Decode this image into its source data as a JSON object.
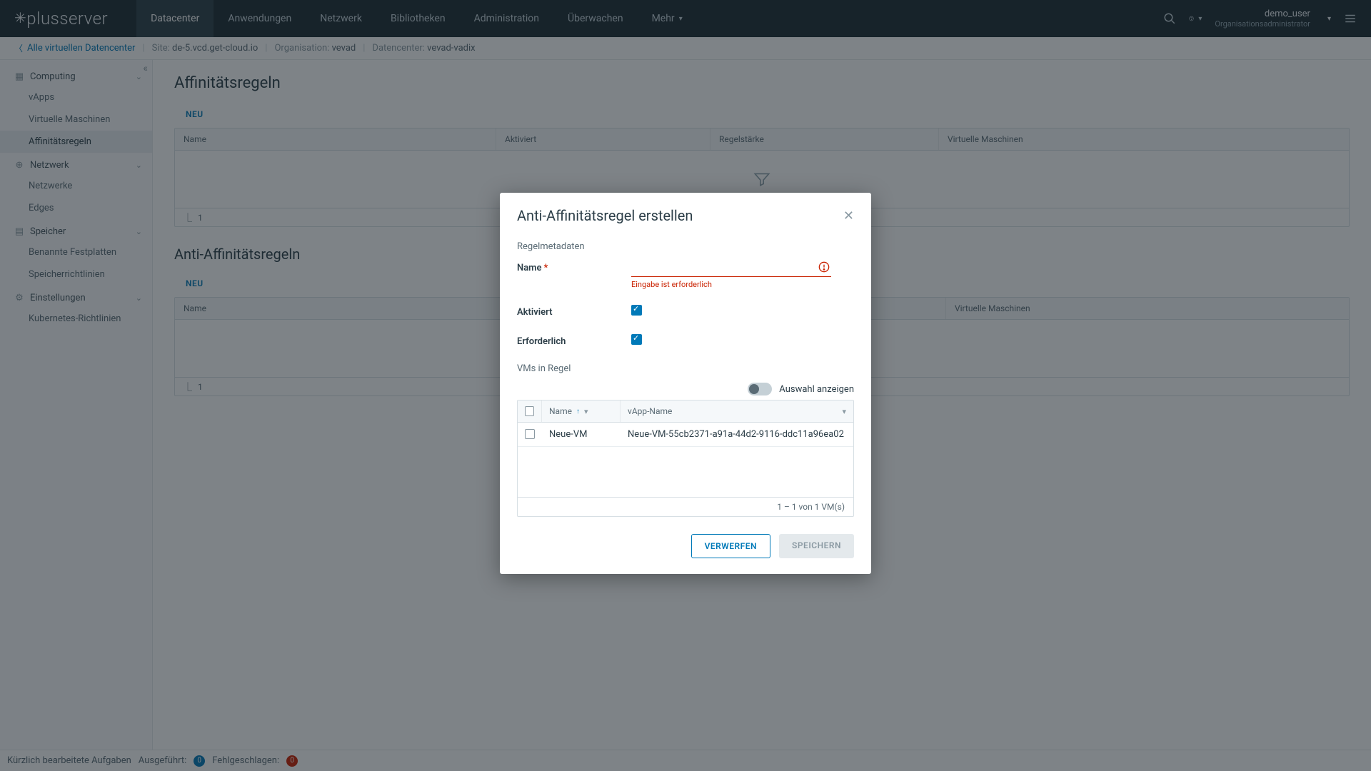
{
  "brand": "plusserver",
  "nav": {
    "items": [
      "Datacenter",
      "Anwendungen",
      "Netzwerk",
      "Bibliotheken",
      "Administration",
      "Überwachen",
      "Mehr"
    ],
    "activeIndex": 0
  },
  "user": {
    "name": "demo_user",
    "role": "Organisationsadministrator"
  },
  "breadcrumb": {
    "back": "Alle virtuellen Datencenter",
    "site_label": "Site:",
    "site_value": "de-5.vcd.get-cloud.io",
    "org_label": "Organisation:",
    "org_value": "vevad",
    "dc_label": "Datencenter:",
    "dc_value": "vevad-vadix"
  },
  "sidebar": {
    "groups": [
      {
        "label": "Computing",
        "items": [
          "vApps",
          "Virtuelle Maschinen",
          "Affinitätsregeln"
        ],
        "activeItem": 2
      },
      {
        "label": "Netzwerk",
        "items": [
          "Netzwerke",
          "Edges"
        ]
      },
      {
        "label": "Speicher",
        "items": [
          "Benannte Festplatten",
          "Speicherrichtlinien"
        ]
      },
      {
        "label": "Einstellungen",
        "items": [
          "Kubernetes-Richtlinien"
        ]
      }
    ]
  },
  "page": {
    "title": "Affinitätsregeln",
    "new_btn": "NEU",
    "grid1_cols": [
      "Name",
      "Aktiviert",
      "Regelstärke",
      "Virtuelle Maschinen"
    ],
    "section2": "Anti-Affinitätsregeln",
    "grid2_cols": [
      "Name",
      "Virtuelle Maschinen"
    ],
    "footer_page": "1"
  },
  "modal": {
    "title": "Anti-Affinitätsregel erstellen",
    "sec_meta": "Regelmetadaten",
    "name_label": "Name",
    "name_error": "Eingabe ist erforderlich",
    "enabled_label": "Aktiviert",
    "required_label": "Erforderlich",
    "sec_vms": "VMs in Regel",
    "switch_label": "Auswahl anzeigen",
    "vm_cols": {
      "name": "Name",
      "vapp": "vApp-Name"
    },
    "vm_rows": [
      {
        "name": "Neue-VM",
        "vapp": "Neue-VM-55cb2371-a91a-44d2-9116-ddc11a96ea02"
      }
    ],
    "vm_foot": "1 – 1 von 1 VM(s)",
    "discard": "VERWERFEN",
    "save": "SPEICHERN"
  },
  "taskbar": {
    "recent": "Kürzlich bearbeitete Aufgaben",
    "done": "Ausgeführt:",
    "done_n": "0",
    "failed": "Fehlgeschlagen:",
    "failed_n": "0"
  }
}
